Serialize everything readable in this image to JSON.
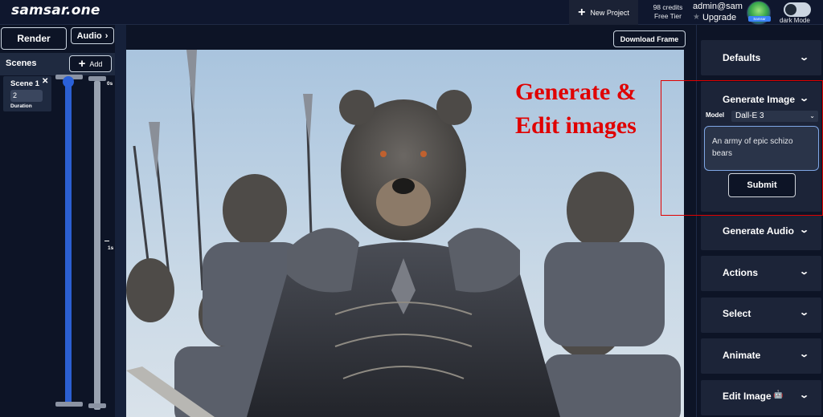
{
  "header": {
    "logo": "samsar.one",
    "new_project": "New Project",
    "credits": "98 credits",
    "tier": "Free Tier",
    "user": "admin@sam",
    "upgrade": "Upgrade",
    "avatar_tag": "Samsar",
    "theme_label": "dark Mode"
  },
  "left": {
    "render_label": "Render",
    "audio_label": "Audio",
    "scenes_label": "Scenes",
    "add_label": "Add",
    "scene": {
      "title": "Scene 1",
      "duration": "2",
      "duration_label": "Duration"
    },
    "timeline_ticks": [
      "0s",
      "1s"
    ]
  },
  "canvas": {
    "download_label": "Download Frame",
    "overlay_line1": "Generate &",
    "overlay_line2": "Edit images"
  },
  "sidebar": {
    "defaults": "Defaults",
    "generate_image": "Generate Image",
    "model_label": "Model",
    "model_value": "Dall-E 3",
    "prompt": "An army of epic schizo bears",
    "submit": "Submit",
    "generate_audio": "Generate Audio",
    "actions": "Actions",
    "select": "Select",
    "animate": "Animate",
    "edit_image": "Edit Image"
  },
  "colors": {
    "background": "#0d1426",
    "panel": "#1c2438",
    "accent_blue": "#2b5fd1",
    "annotation_red": "#e00000"
  }
}
